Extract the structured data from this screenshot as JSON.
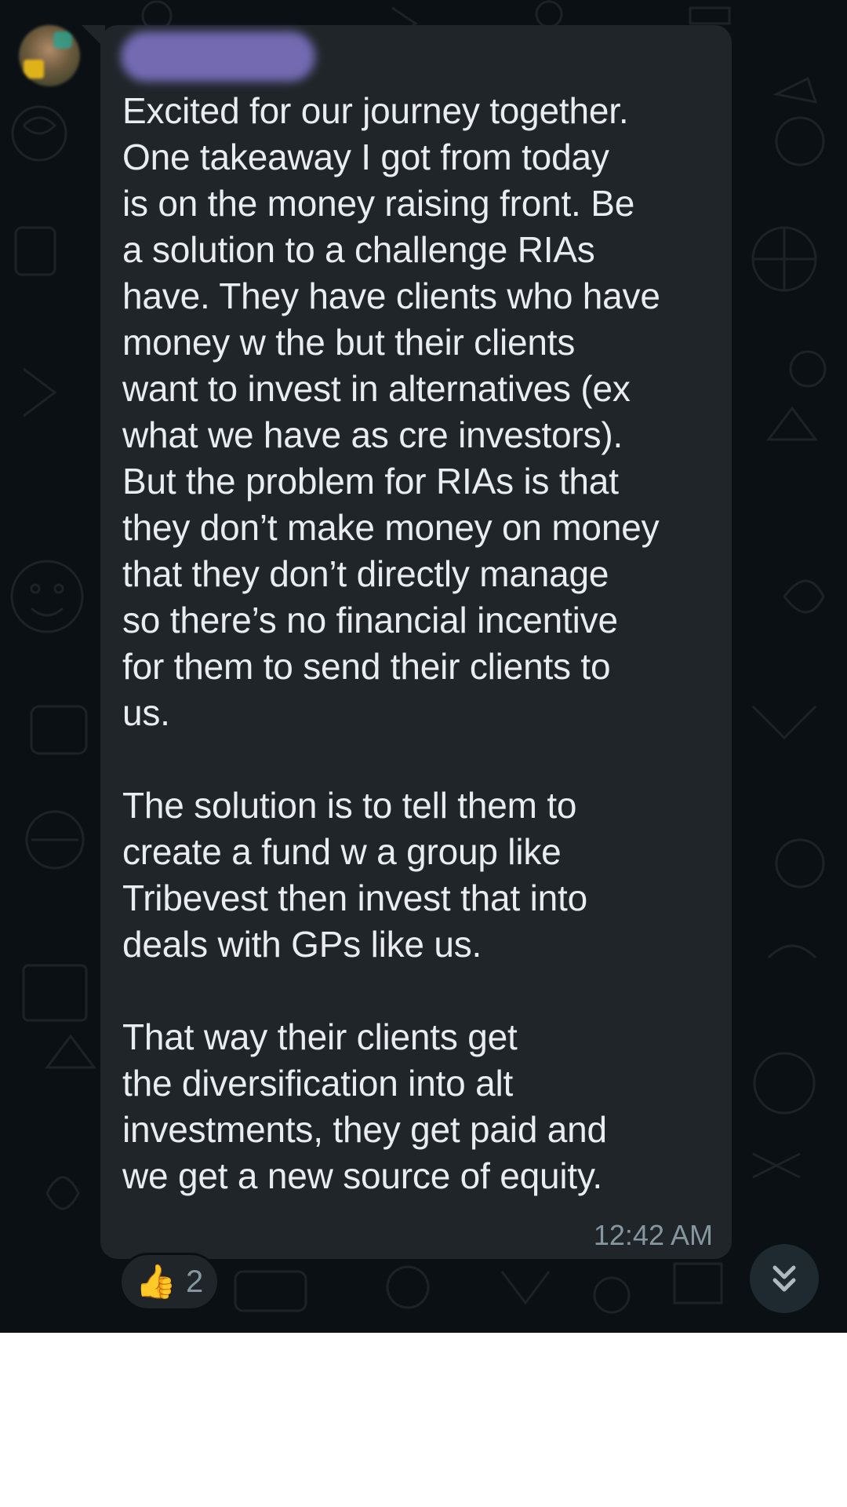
{
  "message": {
    "paragraphs": [
      "Excited for our journey together.\nOne takeaway I got from today\nis on the money raising front. Be\na solution to a challenge RIAs\nhave. They have clients who have\nmoney w the but their clients\nwant to invest in alternatives (ex\nwhat we have as cre investors).\nBut the problem for RIAs is that\nthey don’t make money on money\nthat they don’t directly manage\nso there’s no financial incentive\nfor them to send their clients to\nus.",
      "The solution is to tell them to\ncreate a fund w a group like\nTribevest then invest that into\ndeals with GPs like us.",
      "That way their clients get\nthe diversification into alt\ninvestments, they get paid and\nwe get a new source of equity."
    ],
    "timestamp": "12:42 AM"
  },
  "reaction": {
    "emoji": "👍",
    "count": "2"
  },
  "icons": {
    "scroll_down": "double-chevron-down-icon",
    "reaction": "thumbs-up-icon"
  },
  "colors": {
    "background": "#0b1014",
    "bubble": "#1f2528",
    "text": "#e9edef",
    "meta": "#8696a0"
  }
}
